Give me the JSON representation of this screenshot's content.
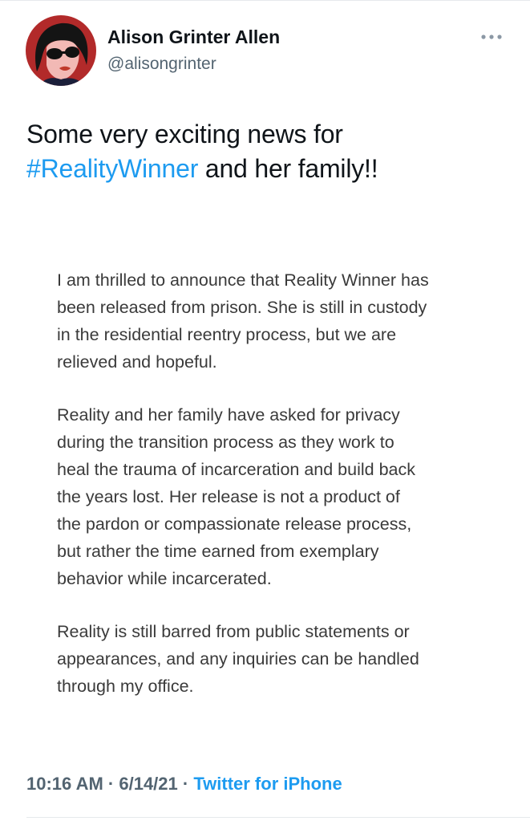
{
  "author": {
    "display_name": "Alison Grinter Allen",
    "handle": "@alisongrinter",
    "avatar_icon": "cartoon-avatar-icon"
  },
  "menu": {
    "icon": "more-options-icon"
  },
  "tweet": {
    "text_before": "Some very exciting news for ",
    "hashtag": "#RealityWinner",
    "text_after": " and her family!!"
  },
  "statement": {
    "paragraphs": [
      "I am thrilled to announce that Reality Winner has\nbeen released from prison. She is still in custody\nin the residential reentry process, but we are\nrelieved and hopeful.",
      "Reality and her family have asked for privacy\nduring the transition process as they work to\nheal the trauma of incarceration and build back\nthe years lost. Her release is not a product of\nthe pardon or compassionate release process,\nbut rather the time earned from exemplary\nbehavior while incarcerated.",
      "Reality is still barred from public statements or\nappearances, and any inquiries can be handled\nthrough my office."
    ]
  },
  "meta": {
    "time": "10:16 AM",
    "separator": "·",
    "date": "6/14/21",
    "source": "Twitter for iPhone"
  },
  "colors": {
    "link": "#1d9bf0",
    "secondary_text": "#536471",
    "primary_text": "#0f1419"
  }
}
